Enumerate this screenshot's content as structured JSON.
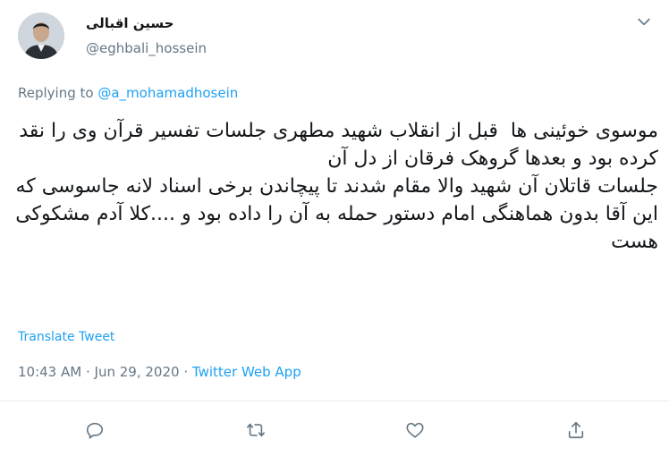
{
  "user": {
    "display_name": "حسین اقبالی",
    "handle": "@eghbali_hossein"
  },
  "reply": {
    "prefix": "Replying to",
    "to": "@a_mohamadhosein"
  },
  "tweet": {
    "text": "موسوی خوئینی ها  قبل از انقلاب شهید مطهری جلسات تفسیر قرآن وی را نقد کرده بود و بعدها گروهک فرقان از دل آن\nجلسات قاتلان آن شهید والا مقام شدند تا پیچاندن برخی اسناد لانه جاسوسی که این آقا بدون هماهنگی امام دستور حمله به آن را داده بود و ....کلا آدم مشکوکی هست",
    "translate_label": "Translate Tweet"
  },
  "meta": {
    "time": "10:43 AM",
    "separator": "·",
    "date": "Jun 29, 2020",
    "source": "Twitter Web App"
  },
  "icons": {
    "reply": "reply-icon",
    "retweet": "retweet-icon",
    "like": "heart-icon",
    "share": "share-icon",
    "caret": "chevron-down-icon"
  },
  "colors": {
    "accent": "#1da1f2",
    "secondary_text": "#657786"
  }
}
